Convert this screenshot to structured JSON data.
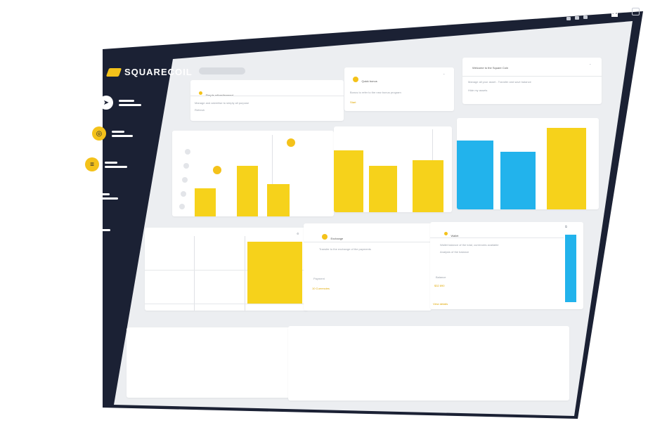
{
  "app": {
    "brand": "SQUARECOIL"
  },
  "topbar": {
    "icons": [
      "play-icon",
      "refresh-icon",
      "more-icon"
    ],
    "logo": "crown-logo",
    "grid": "grid-icon"
  },
  "sidebar": {
    "items": [
      {
        "icon": "send-icon",
        "style": "white"
      },
      {
        "icon": "coins-icon",
        "style": "yellow"
      },
      {
        "icon": "filter-icon",
        "style": "yellow"
      },
      {
        "icon": "circle-icon",
        "style": "outline"
      },
      {
        "icon": "wallet-icon",
        "style": "outline"
      }
    ]
  },
  "colors": {
    "navy": "#1b2134",
    "yellow": "#f6d21b",
    "blue": "#22b3ec",
    "content_bg": "#eceef1"
  },
  "cards_top": [
    {
      "title": "Simple adivertisement",
      "line1": "Manage and advertise to simply all purpose",
      "line2": "Refresh"
    },
    {
      "title": "Quick bonus",
      "line1": "Bonus to refer to the new bonus program",
      "line2": "Start"
    },
    {
      "title": "Welcome to the Square Coin",
      "line1": "Manage all your asset - Transfer and save balance",
      "line2": "Hide my assets"
    }
  ],
  "chart_left": {
    "values": [
      40,
      60,
      42
    ]
  },
  "chart_mid": {
    "values": [
      85,
      63,
      70
    ]
  },
  "chart_right": {
    "values": [
      95,
      80,
      110
    ]
  },
  "cards_mid": [
    {
      "title": "Exchange",
      "line1": "Transfer to the exchange of the payments",
      "label": "Payment",
      "value": "10 Currencies"
    },
    {
      "title": "Wallet",
      "line1": "Wallet balance of the total, currencies available",
      "line2": "Analysis of the balance",
      "label": "Balance",
      "value": "$32 890",
      "footer": "View details"
    }
  ]
}
